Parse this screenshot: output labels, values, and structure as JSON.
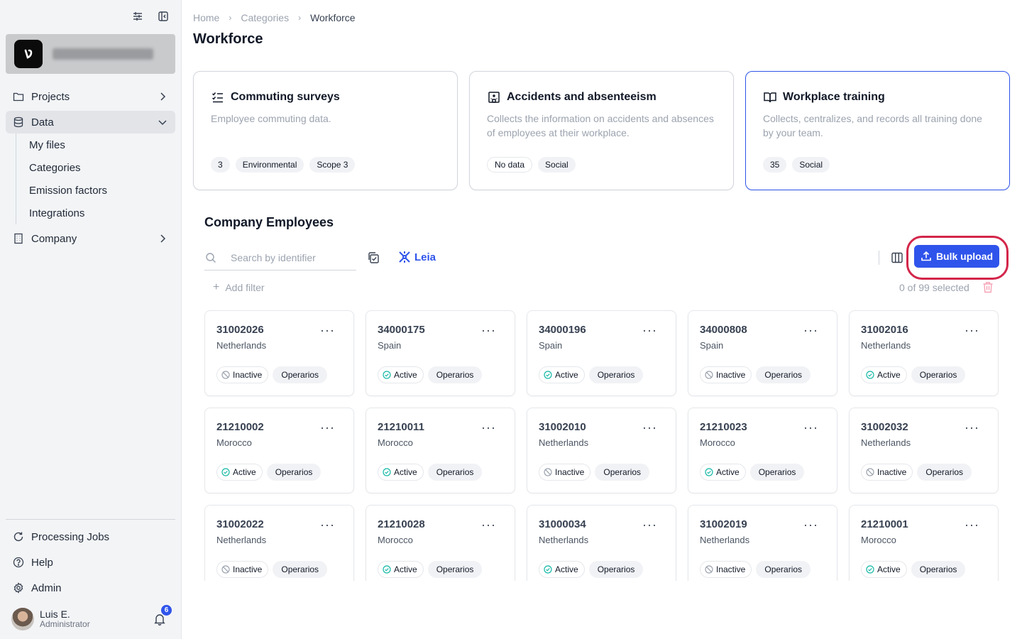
{
  "sidebar": {
    "nav": [
      {
        "label": "Projects"
      },
      {
        "label": "Data"
      },
      {
        "label": "Company"
      }
    ],
    "data_sub": [
      "My files",
      "Categories",
      "Emission factors",
      "Integrations"
    ],
    "bottom": [
      {
        "label": "Processing Jobs"
      },
      {
        "label": "Help"
      },
      {
        "label": "Admin"
      }
    ],
    "user": {
      "name": "Luis E.",
      "role": "Administrator",
      "notifications": "6"
    }
  },
  "breadcrumb": [
    "Home",
    "Categories",
    "Workforce"
  ],
  "page_title": "Workforce",
  "cards": [
    {
      "title": "Commuting surveys",
      "desc": "Employee commuting data.",
      "tags": [
        "3",
        "Environmental",
        "Scope 3"
      ]
    },
    {
      "title": "Accidents and absenteeism",
      "desc": "Collects the information on accidents and absences of employees at their workplace.",
      "tags": [
        "No data",
        "Social"
      ]
    },
    {
      "title": "Workplace training",
      "desc": "Collects, centralizes, and records all training done by your team.",
      "tags": [
        "35",
        "Social"
      ]
    }
  ],
  "section_title": "Company Employees",
  "toolbar": {
    "search_placeholder": "Search by identifier",
    "leia_label": "Leia",
    "bulk_upload_label": "Bulk upload",
    "add_filter_label": "Add filter",
    "selected_text": "0 of 99 selected"
  },
  "colors": {
    "accent": "#2f54eb",
    "highlight": "#d3264a",
    "active": "#14b8a6"
  },
  "employees": [
    {
      "id": "31002026",
      "country": "Netherlands",
      "status": "Inactive",
      "role": "Operarios"
    },
    {
      "id": "34000175",
      "country": "Spain",
      "status": "Active",
      "role": "Operarios"
    },
    {
      "id": "34000196",
      "country": "Spain",
      "status": "Active",
      "role": "Operarios"
    },
    {
      "id": "34000808",
      "country": "Spain",
      "status": "Inactive",
      "role": "Operarios"
    },
    {
      "id": "31002016",
      "country": "Netherlands",
      "status": "Active",
      "role": "Operarios"
    },
    {
      "id": "21210002",
      "country": "Morocco",
      "status": "Active",
      "role": "Operarios"
    },
    {
      "id": "21210011",
      "country": "Morocco",
      "status": "Active",
      "role": "Operarios"
    },
    {
      "id": "31002010",
      "country": "Netherlands",
      "status": "Inactive",
      "role": "Operarios"
    },
    {
      "id": "21210023",
      "country": "Morocco",
      "status": "Active",
      "role": "Operarios"
    },
    {
      "id": "31002032",
      "country": "Netherlands",
      "status": "Inactive",
      "role": "Operarios"
    },
    {
      "id": "31002022",
      "country": "Netherlands",
      "status": "Inactive",
      "role": "Operarios"
    },
    {
      "id": "21210028",
      "country": "Morocco",
      "status": "Active",
      "role": "Operarios"
    },
    {
      "id": "31000034",
      "country": "Netherlands",
      "status": "Active",
      "role": "Operarios"
    },
    {
      "id": "31002019",
      "country": "Netherlands",
      "status": "Inactive",
      "role": "Operarios"
    },
    {
      "id": "21210001",
      "country": "Morocco",
      "status": "Active",
      "role": "Operarios"
    }
  ]
}
